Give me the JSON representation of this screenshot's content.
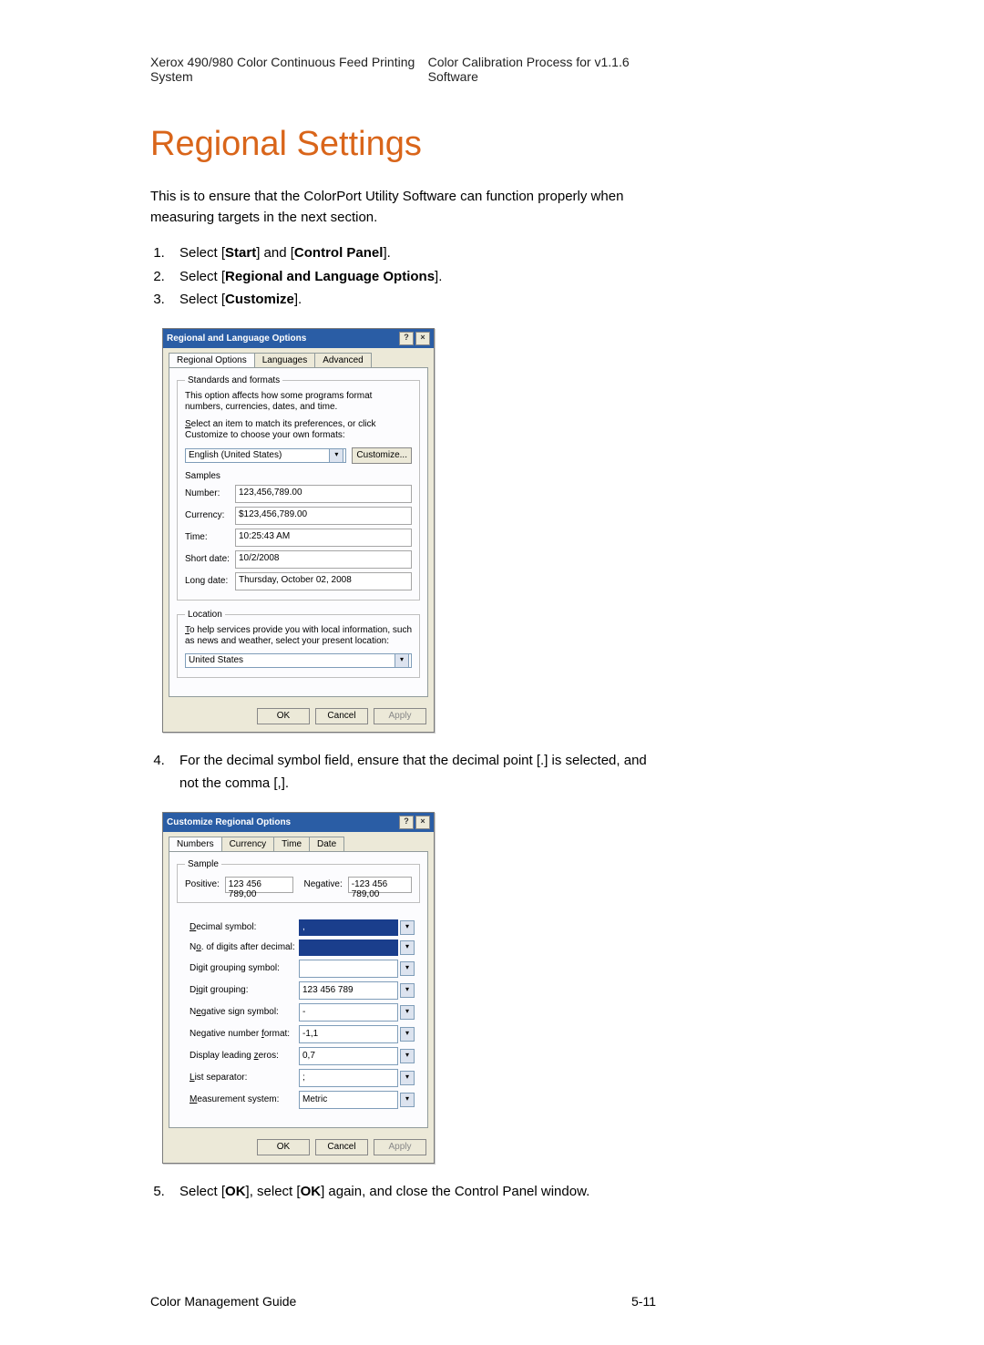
{
  "header": {
    "left": "Xerox 490/980 Color Continuous Feed Printing System",
    "right": "Color Calibration Process for v1.1.6 Software"
  },
  "title": "Regional Settings",
  "intro": "This is to ensure that the ColorPort Utility Software can function properly when measuring targets in the next section.",
  "steps": {
    "s1a": "Select [",
    "s1b": "Start",
    "s1c": "] and [",
    "s1d": "Control Panel",
    "s1e": "].",
    "s2a": "Select [",
    "s2b": "Regional and Language Options",
    "s2c": "].",
    "s3a": "Select [",
    "s3b": "Customize",
    "s3c": "].",
    "s4": "For the decimal symbol field, ensure that the decimal point [.] is selected, and not the comma [,].",
    "s5a": "Select [",
    "s5b": "OK",
    "s5c": "], select [",
    "s5d": "OK",
    "s5e": "] again, and close the Control Panel window."
  },
  "dlg1": {
    "title": "Regional and Language Options",
    "tabs": {
      "t1": "Regional Options",
      "t2": "Languages",
      "t3": "Advanced"
    },
    "standards_legend": "Standards and formats",
    "note1": "This option affects how some programs format numbers, currencies, dates, and time.",
    "note2": "Select an item to match its preferences, or click Customize to choose your own formats:",
    "lang": "English (United States)",
    "customize_btn": "Customize...",
    "samples_label": "Samples",
    "number_label": "Number:",
    "number_value": "123,456,789.00",
    "currency_label": "Currency:",
    "currency_value": "$123,456,789.00",
    "time_label": "Time:",
    "time_value": "10:25:43 AM",
    "shortdate_label": "Short date:",
    "shortdate_value": "10/2/2008",
    "longdate_label": "Long date:",
    "longdate_value": "Thursday, October 02, 2008",
    "location_legend": "Location",
    "location_note": "To help services provide you with local information, such as news and weather, select your present location:",
    "location_value": "United States",
    "ok": "OK",
    "cancel": "Cancel",
    "apply": "Apply"
  },
  "dlg2": {
    "title": "Customize Regional Options",
    "tabs": {
      "t1": "Numbers",
      "t2": "Currency",
      "t3": "Time",
      "t4": "Date"
    },
    "sample_legend": "Sample",
    "positive_label": "Positive:",
    "positive_value": "123 456 789,00",
    "negative_label": "Negative:",
    "negative_value": "-123 456 789,00",
    "decimal_label": "Decimal symbol:",
    "decimal_value": ",",
    "digits_after_label": "No. of digits after decimal:",
    "digits_after_value": "",
    "grouping_symbol_label": "Digit grouping symbol:",
    "grouping_symbol_value": "",
    "grouping_label": "Digit grouping:",
    "grouping_value": "123 456 789",
    "negsign_label": "Negative sign symbol:",
    "negsign_value": "-",
    "negformat_label": "Negative number format:",
    "negformat_value": "-1,1",
    "leadingzeros_label": "Display leading zeros:",
    "leadingzeros_value": "0,7",
    "listsep_label": "List separator:",
    "listsep_value": ";",
    "measurement_label": "Measurement system:",
    "measurement_value": "Metric",
    "ok": "OK",
    "cancel": "Cancel",
    "apply": "Apply"
  },
  "footer": {
    "left": "Color Management Guide",
    "right": "5-11"
  }
}
